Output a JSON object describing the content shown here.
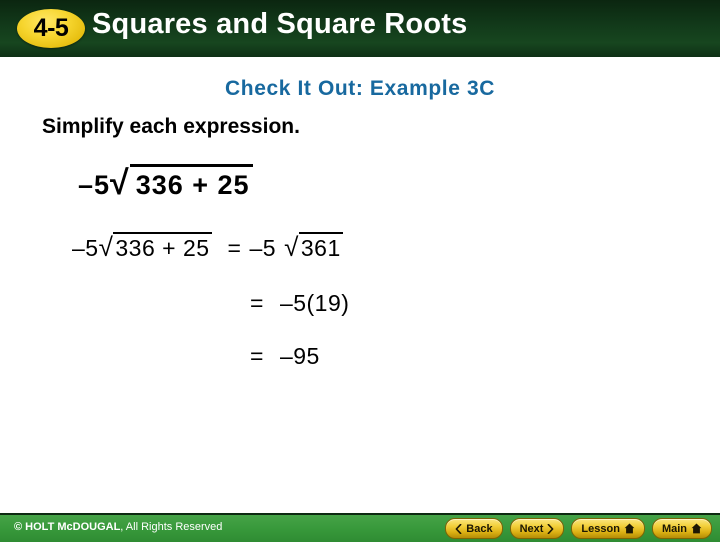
{
  "header": {
    "lesson_number": "4-5",
    "title": "Squares and Square Roots",
    "bg_color": "#123a1a",
    "badge_color": "#f2ce2a"
  },
  "slide": {
    "subtitle": "Check It Out: Example 3C",
    "subtitle_color": "#18699f",
    "instruction": "Simplify each expression.",
    "problem": {
      "coefficient": "–5",
      "radical_sign": "√",
      "radicand": "336 + 25"
    },
    "solution_lines": [
      {
        "lhs_coefficient": "–5",
        "lhs_radical_sign": "√",
        "lhs_radicand": "336 + 25",
        "equals": "=",
        "rhs_coefficient": "–5",
        "rhs_radical_sign": "√",
        "rhs_radicand": "361"
      },
      {
        "equals": "=",
        "expression": "–5(19)"
      },
      {
        "equals": "=",
        "expression": "–95"
      }
    ]
  },
  "footer": {
    "copyright_bold": "© HOLT McDOUGAL",
    "copyright_rest": ", All Rights Reserved",
    "bg_color": "#37983a",
    "buttons": [
      {
        "label": "Back",
        "icon": "chevron-left-icon",
        "icon_side": "left"
      },
      {
        "label": "Next",
        "icon": "chevron-right-icon",
        "icon_side": "right"
      },
      {
        "label": "Lesson",
        "icon": "home-icon",
        "icon_side": "right"
      },
      {
        "label": "Main",
        "icon": "home-icon",
        "icon_side": "right"
      }
    ]
  }
}
